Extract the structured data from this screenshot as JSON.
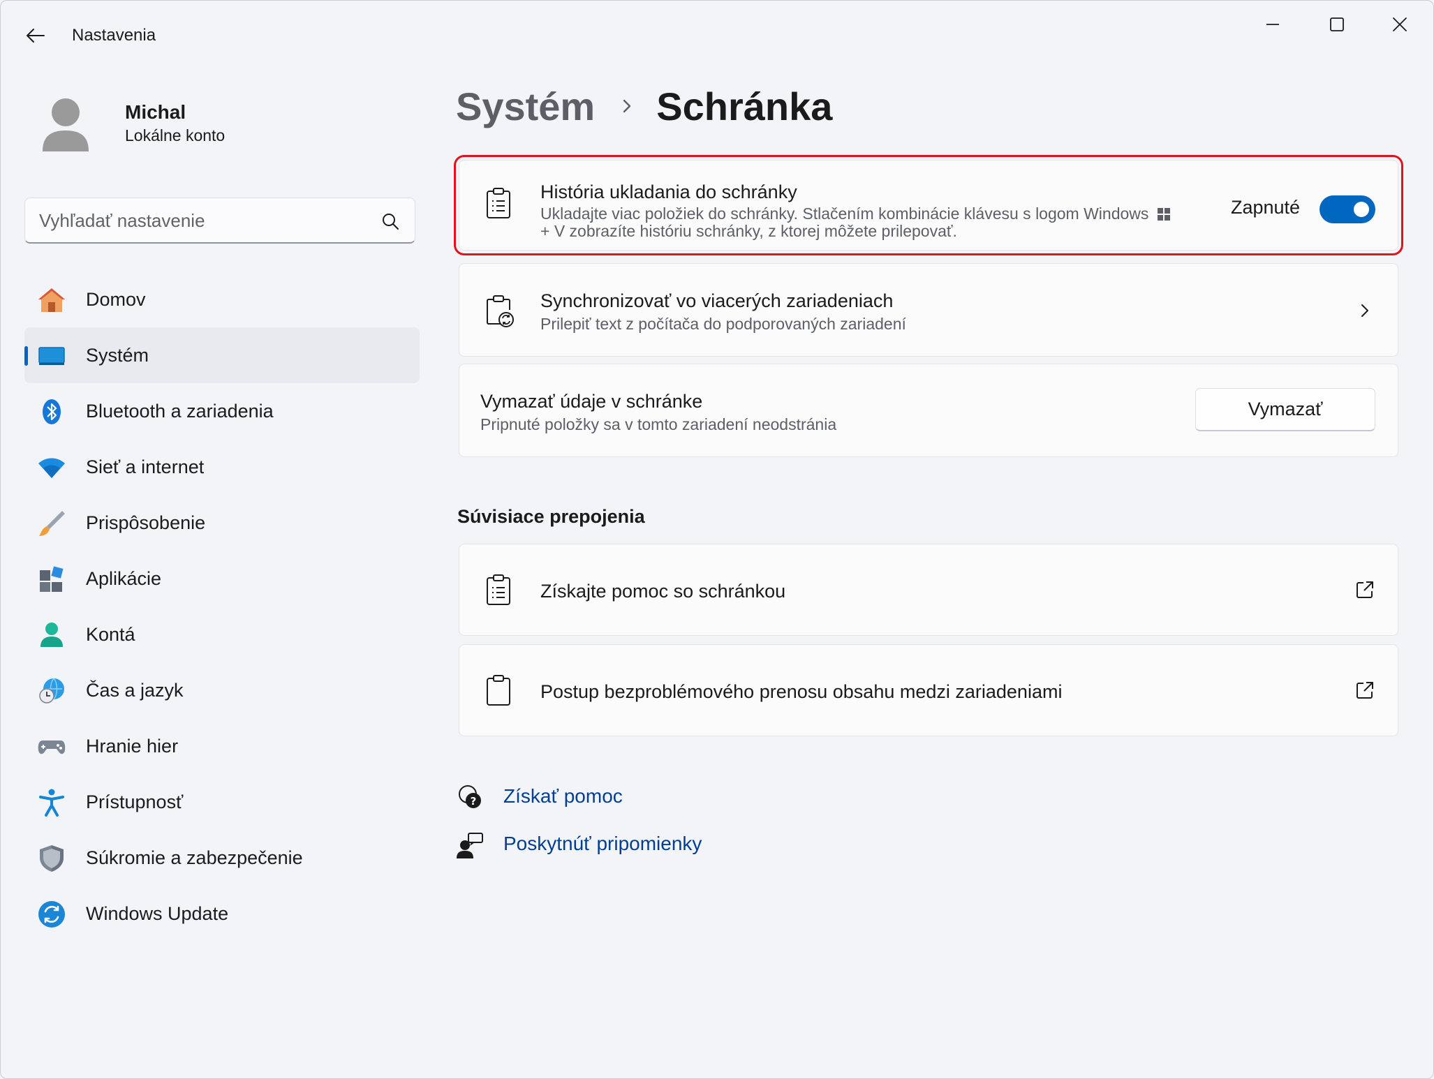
{
  "window": {
    "title": "Nastavenia"
  },
  "profile": {
    "name": "Michal",
    "account_type": "Lokálne konto"
  },
  "search": {
    "placeholder": "Vyhľadať nastavenie"
  },
  "sidebar": {
    "items": [
      {
        "label": "Domov",
        "icon": "home-icon"
      },
      {
        "label": "Systém",
        "icon": "system-icon",
        "active": true
      },
      {
        "label": "Bluetooth a zariadenia",
        "icon": "bluetooth-icon"
      },
      {
        "label": "Sieť a internet",
        "icon": "wifi-icon"
      },
      {
        "label": "Prispôsobenie",
        "icon": "brush-icon"
      },
      {
        "label": "Aplikácie",
        "icon": "apps-icon"
      },
      {
        "label": "Kontá",
        "icon": "accounts-icon"
      },
      {
        "label": "Čas a jazyk",
        "icon": "time-language-icon"
      },
      {
        "label": "Hranie hier",
        "icon": "gaming-icon"
      },
      {
        "label": "Prístupnosť",
        "icon": "accessibility-icon"
      },
      {
        "label": "Súkromie a zabezpečenie",
        "icon": "shield-icon"
      },
      {
        "label": "Windows Update",
        "icon": "windows-update-icon"
      }
    ]
  },
  "breadcrumb": {
    "parent": "Systém",
    "current": "Schránka"
  },
  "clipboard_history": {
    "title": "História ukladania do schránky",
    "desc_line1": "Ukladajte viac položiek do schránky. Stlačením kombinácie klávesu s logom Windows",
    "desc_line2": "+ V zobrazíte históriu schránky, z ktorej môžete prilepovať.",
    "toggle_label": "Zapnuté",
    "toggle_on": true
  },
  "sync": {
    "title": "Synchronizovať vo viacerých zariadeniach",
    "desc": "Prilepiť text z počítača do podporovaných zariadení"
  },
  "clear": {
    "title": "Vymazať údaje v schránke",
    "desc": "Pripnuté položky sa v tomto zariadení neodstránia",
    "button": "Vymazať"
  },
  "related": {
    "section_title": "Súvisiace prepojenia",
    "links": [
      {
        "label": "Získajte pomoc so schránkou"
      },
      {
        "label": "Postup bezproblémového prenosu obsahu medzi zariadeniami"
      }
    ]
  },
  "help": {
    "get_help": "Získať pomoc",
    "feedback": "Poskytnúť pripomienky"
  },
  "colors": {
    "accent": "#0067c0",
    "highlight": "#e0121b",
    "link": "#003e92"
  }
}
